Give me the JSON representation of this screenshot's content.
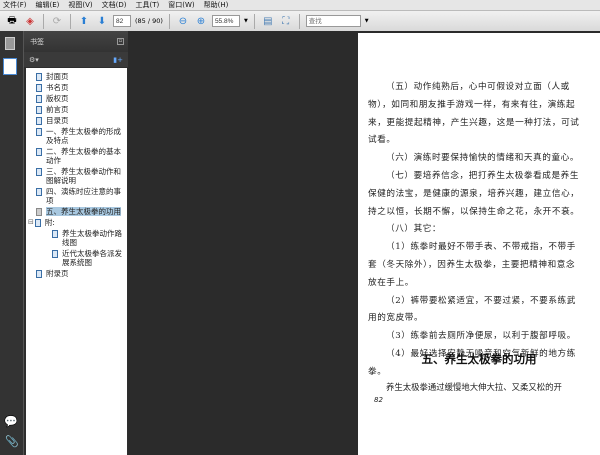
{
  "menu": [
    "文件(F)",
    "编辑(E)",
    "视图(V)",
    "文档(D)",
    "工具(T)",
    "窗口(W)",
    "帮助(H)"
  ],
  "toolbar": {
    "page_input": "82",
    "page_count": "(85 / 90)",
    "zoom": "55.8%",
    "search_placeholder": "查找"
  },
  "panel": {
    "title": "书签"
  },
  "bookmarks": [
    {
      "label": "封面页"
    },
    {
      "label": "书名页"
    },
    {
      "label": "版权页"
    },
    {
      "label": "前言页"
    },
    {
      "label": "目录页"
    },
    {
      "label": "一、养生太极拳的形成及特点"
    },
    {
      "label": "二、养生太极拳的基本动作"
    },
    {
      "label": "三、养生太极拳动作和图解说明"
    },
    {
      "label": "四、演练时应注意的事项"
    },
    {
      "label": "五、养生太极拳的功用",
      "selected": true
    },
    {
      "label": "附:",
      "expanded": true
    },
    {
      "label": "养生太极拳动作路线图",
      "child": true
    },
    {
      "label": "近代太极拳各派发展系统图",
      "child": true
    },
    {
      "label": "附录页"
    }
  ],
  "document": {
    "lines": [
      {
        "t": "（五）动作纯熟后，心中可假设对立面（人或",
        "i": 1
      },
      {
        "t": "物），如同和朋友推手游戏一样，有来有往，演练起",
        "i": 0
      },
      {
        "t": "来，更能提起精神，产生兴趣，这是一种打法，可试",
        "i": 0
      },
      {
        "t": "试看。",
        "i": 0
      },
      {
        "t": "（六）演练时要保持愉快的情绪和天真的童心。",
        "i": 1
      },
      {
        "t": "（七）要培养信念，把打养生太极拳看成是养生",
        "i": 1
      },
      {
        "t": "保健的法宝，是健康的源泉，培养兴趣，建立信心，",
        "i": 0
      },
      {
        "t": "持之以恒，长期不懈，以保持生命之花，永开不衰。",
        "i": 0
      },
      {
        "t": "（八）其它：",
        "i": 1
      },
      {
        "t": "（1）练拳时最好不带手表、不带戒指，不带手",
        "i": 1
      },
      {
        "t": "套（冬天除外），因养生太极拳，主要把精神和意念",
        "i": 0
      },
      {
        "t": "放在手上。",
        "i": 0
      },
      {
        "t": "（2）裤带要松紧适宜，不要过紧，不要系练武",
        "i": 1
      },
      {
        "t": "用的宽皮带。",
        "i": 0
      },
      {
        "t": "（3）练拳前去厕所净便尿，以利于腹部呼吸。",
        "i": 1
      },
      {
        "t": "（4）最好选择安静无噪音和空气新鲜的地方练",
        "i": 1
      },
      {
        "t": "拳。",
        "i": 0
      }
    ],
    "heading": "五、养生太极拳的功用",
    "last_line": "养生太极拳通过缓慢地大伸大拉、又柔又松的开",
    "page_number": "82"
  }
}
